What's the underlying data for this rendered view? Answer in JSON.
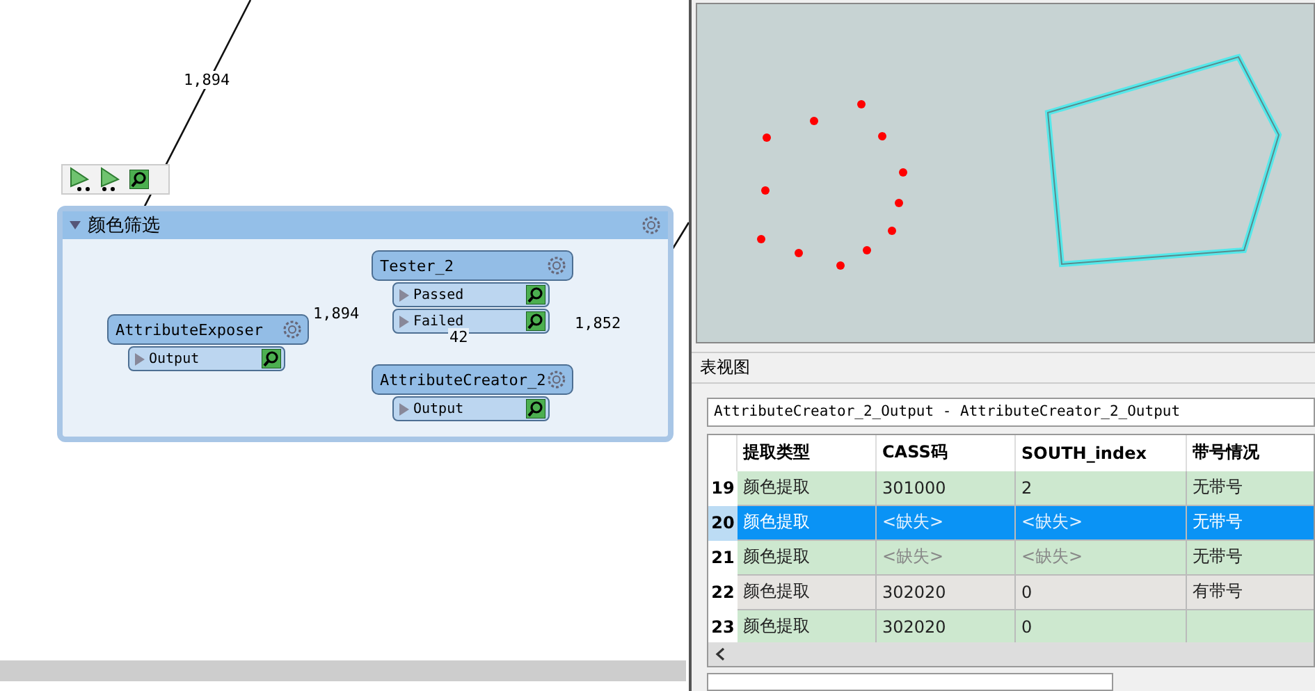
{
  "canvas": {
    "bookmark": {
      "title": "颜色筛选",
      "expanded": true
    },
    "transformers": [
      {
        "name": "AttributeExposer",
        "ports": [
          {
            "name": "Output"
          }
        ]
      },
      {
        "name": "Tester_2",
        "ports": [
          {
            "name": "Passed"
          },
          {
            "name": "Failed"
          }
        ]
      },
      {
        "name": "AttributeCreator_2",
        "ports": [
          {
            "name": "Output"
          }
        ]
      }
    ],
    "feature_counts": [
      "1,894",
      "1,894",
      "1,852",
      "42"
    ]
  },
  "table_view": {
    "title": "表视图",
    "dataset": "AttributeCreator_2_Output - AttributeCreator_2_Output",
    "columns": [
      "提取类型",
      "CASS码",
      "SOUTH_index",
      "带号情况"
    ],
    "rows": [
      {
        "index": "19",
        "selected": false,
        "highlighted": true,
        "cells": [
          {
            "text": "颜色提取",
            "missing": false
          },
          {
            "text": "301000",
            "missing": false
          },
          {
            "text": "2",
            "missing": false
          },
          {
            "text": "无带号",
            "missing": false
          }
        ]
      },
      {
        "index": "20",
        "selected": true,
        "cells": [
          {
            "text": "颜色提取",
            "missing": false
          },
          {
            "text": "<缺失>",
            "missing": true
          },
          {
            "text": "<缺失>",
            "missing": true
          },
          {
            "text": "无带号",
            "missing": false
          }
        ]
      },
      {
        "index": "21",
        "selected": false,
        "highlighted": true,
        "cells": [
          {
            "text": "颜色提取",
            "missing": false
          },
          {
            "text": "<缺失>",
            "missing": true
          },
          {
            "text": "<缺失>",
            "missing": true
          },
          {
            "text": "无带号",
            "missing": false
          }
        ]
      },
      {
        "index": "22",
        "selected": false,
        "highlighted": false,
        "cells": [
          {
            "text": "颜色提取",
            "missing": false
          },
          {
            "text": "302020",
            "missing": false
          },
          {
            "text": "0",
            "missing": false
          },
          {
            "text": "有带号",
            "missing": false
          }
        ]
      },
      {
        "index": "23",
        "selected": false,
        "highlighted": true,
        "cells": [
          {
            "text": "颜色提取",
            "missing": false
          },
          {
            "text": "302020",
            "missing": false
          },
          {
            "text": "0",
            "missing": false
          }
        ]
      }
    ]
  }
}
